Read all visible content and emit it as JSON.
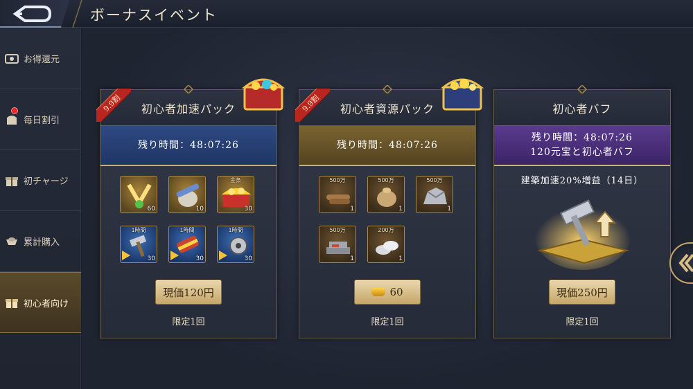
{
  "header": {
    "title": "ボーナスイベント"
  },
  "sidebar": {
    "items": [
      {
        "label": "お得還元",
        "icon": "cash-icon"
      },
      {
        "label": "毎日割引",
        "icon": "discount-bag-icon",
        "notify": true
      },
      {
        "label": "初チャージ",
        "icon": "gift-icon"
      },
      {
        "label": "累計購入",
        "icon": "ingot-icon"
      },
      {
        "label": "初心者向け",
        "icon": "gift-icon",
        "active": true
      }
    ]
  },
  "cards": [
    {
      "title": "初心者加速パック",
      "ribbon": "9.9割",
      "timer_label": "残り時間：",
      "timer": "48:07:26",
      "items": [
        {
          "qty": "60",
          "tag": "",
          "icon": "gold-emblem-icon"
        },
        {
          "qty": "10",
          "tag": "",
          "icon": "scroll-sack-icon"
        },
        {
          "qty": "30",
          "tag": "金条",
          "icon": "gold-chest-icon"
        },
        {
          "qty": "30",
          "tag": "1時間",
          "icon": "hammer-speedup-icon"
        },
        {
          "qty": "30",
          "tag": "1時間",
          "icon": "scroll-speedup-icon"
        },
        {
          "qty": "30",
          "tag": "1時間",
          "icon": "shield-speedup-icon"
        }
      ],
      "price": "現価120円",
      "limit": "限定1回"
    },
    {
      "title": "初心者資源パック",
      "ribbon": "9.9割",
      "timer_label": "残り時間：",
      "timer": "48:07:26",
      "items": [
        {
          "qty": "1",
          "tag": "500万",
          "icon": "wood-icon"
        },
        {
          "qty": "1",
          "tag": "500万",
          "icon": "grain-sack-icon"
        },
        {
          "qty": "1",
          "tag": "500万",
          "icon": "stone-icon"
        },
        {
          "qty": "1",
          "tag": "500万",
          "icon": "iron-icon"
        },
        {
          "qty": "1",
          "tag": "200万",
          "icon": "silver-icon"
        }
      ],
      "price": "60",
      "limit": "限定1回"
    },
    {
      "title": "初心者バフ",
      "timer_label": "残り時間：",
      "timer": "48:07:26",
      "subtitle": "120元宝と初心者バフ",
      "buff": "建築加速20%増益（14日）",
      "price": "現価250円",
      "limit": "限定1回"
    }
  ],
  "colors": {
    "accent_gold": "#c6a66a",
    "ribbon_red": "#b9261f",
    "notify_red": "#e02a2a"
  }
}
